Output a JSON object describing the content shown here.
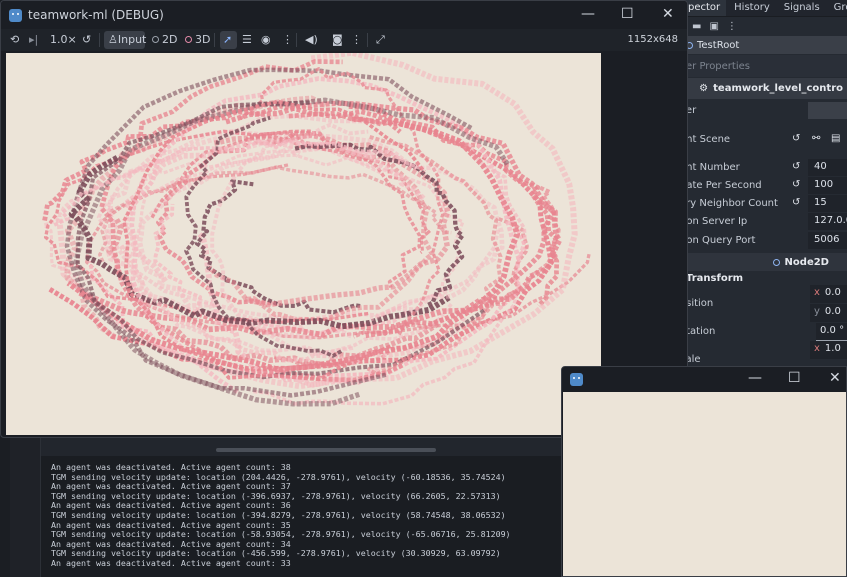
{
  "main_window": {
    "title": "teamwork-ml (DEBUG)",
    "controls": {
      "minimize": "—",
      "maximize": "☐",
      "close": "✕"
    },
    "toolbar": {
      "speed": "1.0×",
      "input_label": "Input",
      "mode_2d": "2D",
      "mode_3d": "3D",
      "resolution": "1152x648"
    }
  },
  "second_window": {
    "controls": {
      "minimize": "—",
      "maximize": "☐",
      "close": "✕"
    }
  },
  "inspector": {
    "tabs": [
      "pector",
      "History",
      "Signals",
      "Grou"
    ],
    "root_node": "TestRoot",
    "filter_placeholder": "er Properties",
    "script_name": "teamwork_level_contro",
    "properties": [
      {
        "label": "yer",
        "value": "",
        "revert": false
      },
      {
        "label": "ent Scene",
        "value": "",
        "revert": true
      },
      {
        "label": "ent Number",
        "value": "40",
        "revert": true
      },
      {
        "label": "date Per Second",
        "value": "100",
        "revert": true
      },
      {
        "label": "ery Neighbor Count",
        "value": "15",
        "revert": true
      },
      {
        "label": "hon Server Ip",
        "value": "127.0.0.",
        "revert": false
      },
      {
        "label": "hon Query Port",
        "value": "5006",
        "revert": false
      }
    ],
    "node2d_header": "Node2D",
    "transform_label": "Transform",
    "position_label": "osition",
    "position_x": "0.0",
    "position_y": "0.0",
    "rotation_label": "otation",
    "rotation_value": "0.0 °",
    "scale_label": "cale",
    "scale_x": "1.0"
  },
  "output": {
    "lines": [
      "An agent was deactivated. Active agent count: 38",
      "TGM sending velocity update: location (204.4426, -278.9761), velocity (-60.18536, 35.74524)",
      "An agent was deactivated. Active agent count: 37",
      "TGM sending velocity update: location (-396.6937, -278.9761), velocity (66.2605, 22.57313)",
      "An agent was deactivated. Active agent count: 36",
      "TGM sending velocity update: location (-394.8279, -278.9761), velocity (58.74548, 38.06532)",
      "An agent was deactivated. Active agent count: 35",
      "TGM sending velocity update: location (-58.93054, -278.9761), velocity (-65.06716, 25.81209)",
      "An agent was deactivated. Active agent count: 34",
      "TGM sending velocity update: location (-456.599, -278.9761), velocity (30.30929, 63.09792)",
      "An agent was deactivated. Active agent count: 33"
    ]
  },
  "colors": {
    "viewport_bg": "#ece4d8",
    "trail_light": "#f4b8bf",
    "trail_mid": "#e8848f",
    "trail_dark": "#7a4a58",
    "accent_blue": "#4f8ac9"
  }
}
